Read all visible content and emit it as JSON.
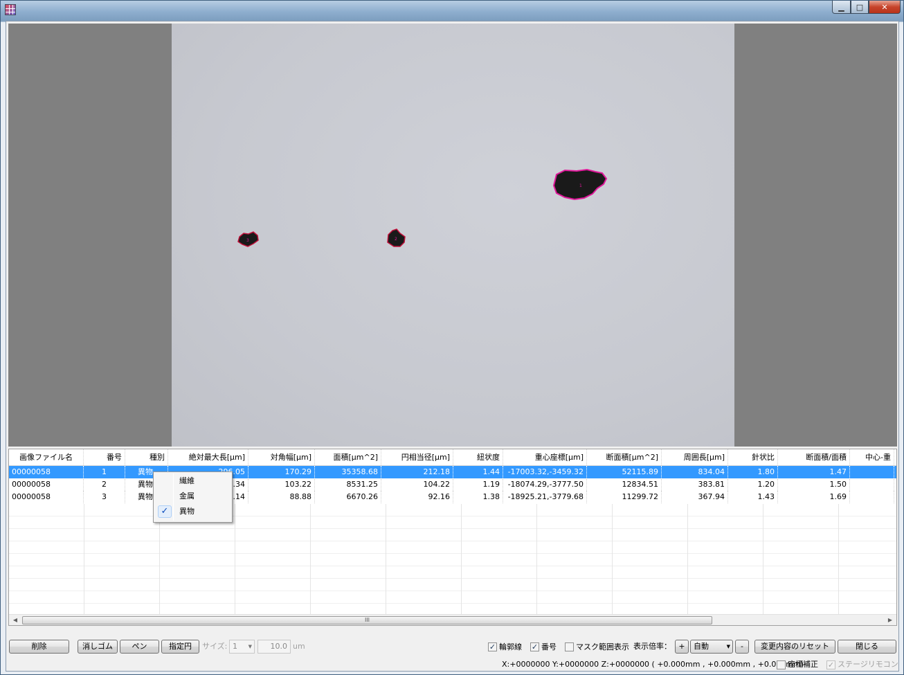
{
  "window": {
    "title": "",
    "controls": {
      "minimize": "▁",
      "maximize": "□",
      "close": "✕"
    }
  },
  "particles": [
    {
      "label": "1"
    },
    {
      "label": "2"
    },
    {
      "label": "3"
    }
  ],
  "table": {
    "columns": [
      "画像ファイル名",
      "番号",
      "種別",
      "絶対最大長[μm]",
      "対角幅[μm]",
      "面積[μm^2]",
      "円相当径[μm]",
      "紐状度",
      "重心座標[μm]",
      "断面積[μm^2]",
      "周囲長[μm]",
      "針状比",
      "断面積/面積",
      "中心-重"
    ],
    "rows": [
      {
        "file": "00000058",
        "no": "1",
        "kind": "異物",
        "abs_max_len": "296.05",
        "diag_width": "170.29",
        "area": "35358.68",
        "eq_diam": "212.18",
        "string_deg": "1.44",
        "centroid": "-17003.32,-3459.32",
        "cross_area": "52115.89",
        "perimeter": "834.04",
        "needle_ratio": "1.80",
        "cross_over_area": "1.47"
      },
      {
        "file": "00000058",
        "no": "2",
        "kind": "異物",
        "abs_max_len": "154.34",
        "diag_width": "103.22",
        "area": "8531.25",
        "eq_diam": "104.22",
        "string_deg": "1.19",
        "centroid": "-18074.29,-3777.50",
        "cross_area": "12834.51",
        "perimeter": "383.81",
        "needle_ratio": "1.20",
        "cross_over_area": "1.50"
      },
      {
        "file": "00000058",
        "no": "3",
        "kind": "異物",
        "abs_max_len": "127.14",
        "diag_width": "88.88",
        "area": "6670.26",
        "eq_diam": "92.16",
        "string_deg": "1.38",
        "centroid": "-18925.21,-3779.68",
        "cross_area": "11299.72",
        "perimeter": "367.94",
        "needle_ratio": "1.43",
        "cross_over_area": "1.69"
      }
    ],
    "scroll_grip": "III"
  },
  "context_menu": {
    "items": [
      {
        "label": "繊維",
        "checked": false
      },
      {
        "label": "金属",
        "checked": false
      },
      {
        "label": "異物",
        "checked": true
      }
    ],
    "check_glyph": "✓"
  },
  "toolbar": {
    "delete": "削除",
    "eraser": "消しゴム",
    "pen": "ペン",
    "circle": "指定円",
    "size_label": "サイズ:",
    "size_value": "1",
    "size_um_value": "10.0",
    "size_unit": "um",
    "outline_label": "輪郭線",
    "outline_checked": true,
    "number_label": "番号",
    "number_checked": true,
    "mask_label": "マスク範囲表示",
    "mask_checked": false,
    "zoom_label": "表示倍率：",
    "zoom_plus": "+",
    "zoom_value": "自動",
    "zoom_minus": "-",
    "reset_label": "変更内容のリセット",
    "close_label": "閉じる"
  },
  "status": {
    "coords": "X:+0000000  Y:+0000000  Z:+0000000 ( +0.000mm ,  +0.000mm ,  +0.000mm)",
    "coord_correction_label": "座標補正",
    "coord_correction_checked": false,
    "stage_remote_label": "ステージリモコン",
    "stage_remote_checked": true
  },
  "colors": {
    "selection": "#3399ff",
    "outline": "#e0189a",
    "viewer_bg": "#808080"
  }
}
